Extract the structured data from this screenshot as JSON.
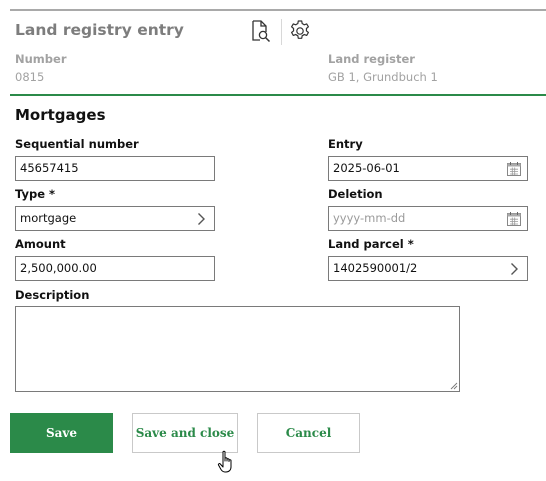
{
  "header": {
    "title": "Land registry entry",
    "icons": [
      "document-search-icon",
      "gear-icon"
    ]
  },
  "meta": {
    "number_label": "Number",
    "number_value": "0815",
    "land_register_label": "Land register",
    "land_register_value": "GB 1, Grundbuch 1"
  },
  "section": {
    "title": "Mortgages"
  },
  "form": {
    "sequential_number": {
      "label": "Sequential number",
      "value": "45657415"
    },
    "entry": {
      "label": "Entry",
      "value": "2025-06-01"
    },
    "type": {
      "label": "Type *",
      "value": "mortgage"
    },
    "deletion": {
      "label": "Deletion",
      "value": "",
      "placeholder": "yyyy-mm-dd"
    },
    "amount": {
      "label": "Amount",
      "value": "2,500,000.00"
    },
    "land_parcel": {
      "label": "Land parcel *",
      "value": "1402590001/2"
    },
    "description": {
      "label": "Description",
      "value": ""
    }
  },
  "buttons": {
    "save": "Save",
    "save_and_close": "Save and close",
    "cancel": "Cancel"
  },
  "colors": {
    "accent": "#2b8a49",
    "header_text": "#7d7d7d",
    "meta_text": "#a2a2a2"
  }
}
